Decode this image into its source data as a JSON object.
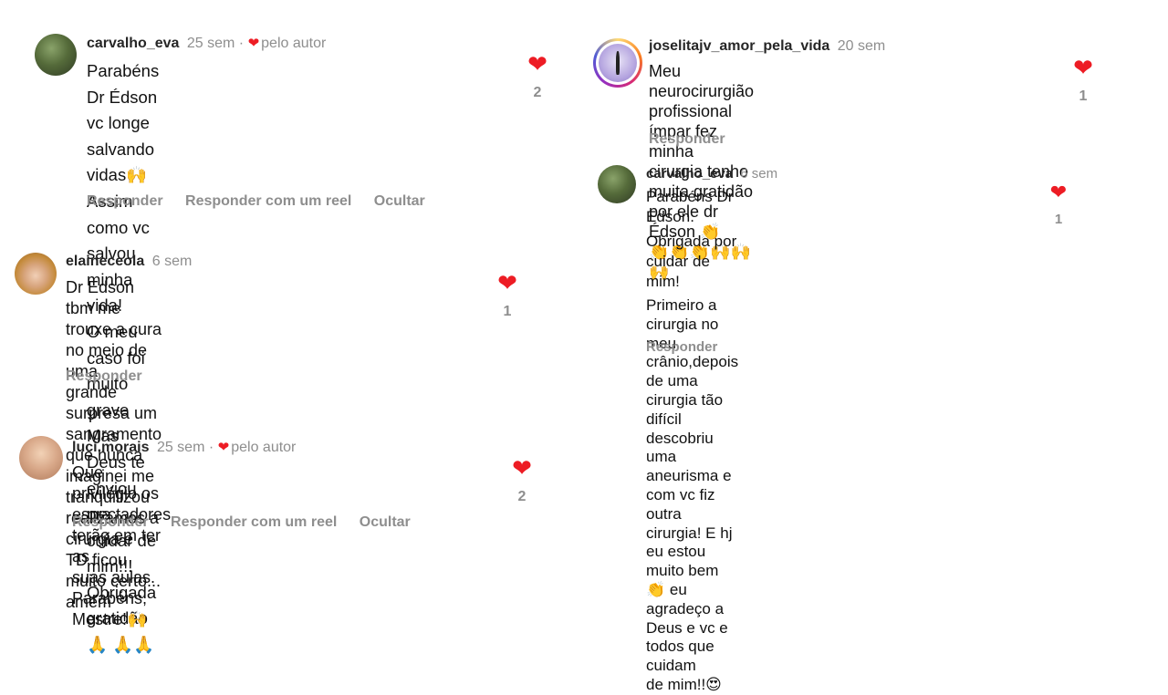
{
  "comments": [
    {
      "user": "carvalho_eva",
      "time": "25 sem",
      "sep": "·",
      "author_heart": "❤",
      "author_label": "pelo autor",
      "lines": [
        "Parabéns Dr Édson vc longe salvando vidas🙌",
        "Assim como vc salvou minha vida!",
        "O meu caso foi muito grave",
        "Mas Deus te enviou pra cuidar de mim!!!",
        "Obrigada gratidão 🙏 🙏🙏"
      ],
      "actions": [
        "Responder",
        "Responder com um reel",
        "Ocultar"
      ],
      "heart": "❤",
      "likes": "2"
    },
    {
      "user": "elaineceola",
      "time": "6 sem",
      "lines": [
        "Dr Edson tbm me trouxe a cura no meio de uma",
        "grande surpresa um sangramento que nunca",
        "imaginei me tranquilizou realizamos a cirurgia e",
        "TD ficou muito certo... amém"
      ],
      "actions": [
        "Responder"
      ],
      "heart": "❤",
      "likes": "1"
    },
    {
      "user": "luci.morais",
      "time": "25 sem",
      "sep": "·",
      "author_heart": "❤",
      "author_label": "pelo autor",
      "lines": [
        "Que privilégio os espectadores terão em ter as",
        "suas aulas. Parabéns, Mestre!🙌"
      ],
      "actions": [
        "Responder",
        "Responder com um reel",
        "Ocultar"
      ],
      "heart": "❤",
      "likes": "2"
    },
    {
      "user": "joselitajv_amor_pela_vida",
      "time": "20 sem",
      "lines": [
        "Meu neurocirurgião profissional ímpar fez minha",
        "cirurgia tenho muita gratidão por ele dr Édson 👏",
        "👏👏👏🙌🙌🙌"
      ],
      "actions": [
        "Responder"
      ],
      "heart": "❤",
      "likes": "1"
    },
    {
      "user": "carvalho_eva",
      "time": "6 sem",
      "lines": [
        "Parabéns  Dr Edson.",
        "Obrigada por cuidar de mim!",
        "Primeiro  a cirurgia no meu crânio,depois de uma",
        "cirurgia tão difícil descobriu uma aneurisma e",
        "com vc fiz outra cirurgia! E hj eu estou muito bem",
        "👏 eu agradeço a Deus e vc e todos que cuidam",
        "de mim!!😍"
      ],
      "actions": [
        "Responder"
      ],
      "heart": "❤",
      "likes": "1"
    }
  ]
}
